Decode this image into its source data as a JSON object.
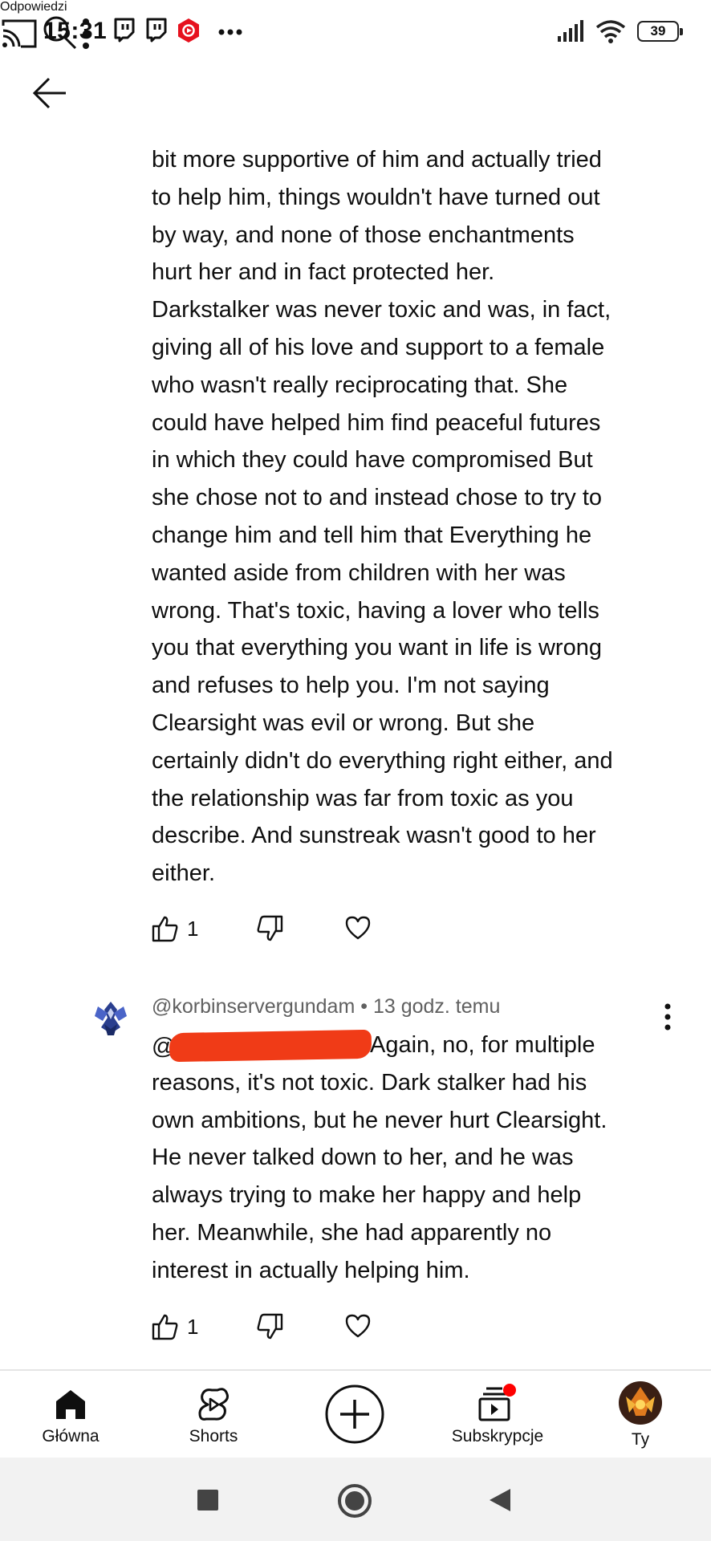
{
  "status_bar": {
    "time": "15:31",
    "battery": "39",
    "notification_icons": [
      "twitch-icon",
      "twitch-icon",
      "youtube-icon",
      "more-dots"
    ]
  },
  "header": {
    "title": "Odpowiedzi"
  },
  "comment1": {
    "lines": [
      "bit more supportive of him and actually tried",
      "to help him, things wouldn't have turned out",
      "by way, and none of those enchantments",
      "hurt her and in fact protected her.",
      "Darkstalker was never toxic and was, in fact,",
      "giving all of his love and support to a female",
      "who wasn't really reciprocating that. She",
      "could have helped him find peaceful futures",
      "in which they could have compromised But",
      "she chose not to and instead chose to try to",
      "change him and tell him that Everything he",
      "wanted aside from children with her was",
      "wrong. That's toxic, having a lover who tells",
      "you that everything you want in life is wrong",
      "and refuses to help you. I'm not saying",
      "Clearsight was evil or wrong. But she",
      "certainly didn't do everything right either, and",
      "the relationship was far from toxic as you",
      "describe. And sunstreak wasn't good to her",
      "either."
    ],
    "likes": "1"
  },
  "comment2": {
    "author": "@korbinservergundam",
    "time": "13 godz. temu",
    "mention_prefix": "@",
    "first_line_rest": "Again, no, for multiple",
    "lines": [
      "reasons, it's not toxic. Dark stalker had his",
      "own ambitions, but he never hurt Clearsight.",
      "He never talked down to her, and he was",
      "always trying to make her happy and help",
      "her. Meanwhile, she had apparently no",
      "interest in actually helping him."
    ],
    "likes": "1"
  },
  "bottom_nav": {
    "items": [
      {
        "label": "Główna",
        "icon": "home-icon"
      },
      {
        "label": "Shorts",
        "icon": "shorts-icon"
      },
      {
        "label": "",
        "icon": "create-icon"
      },
      {
        "label": "Subskrypcje",
        "icon": "subscriptions-icon"
      },
      {
        "label": "Ty",
        "icon": "avatar"
      }
    ]
  },
  "colors": {
    "accent_red": "#ff0000",
    "text": "#0f0f0f",
    "secondary_text": "#606060",
    "redaction": "#f03b17"
  }
}
